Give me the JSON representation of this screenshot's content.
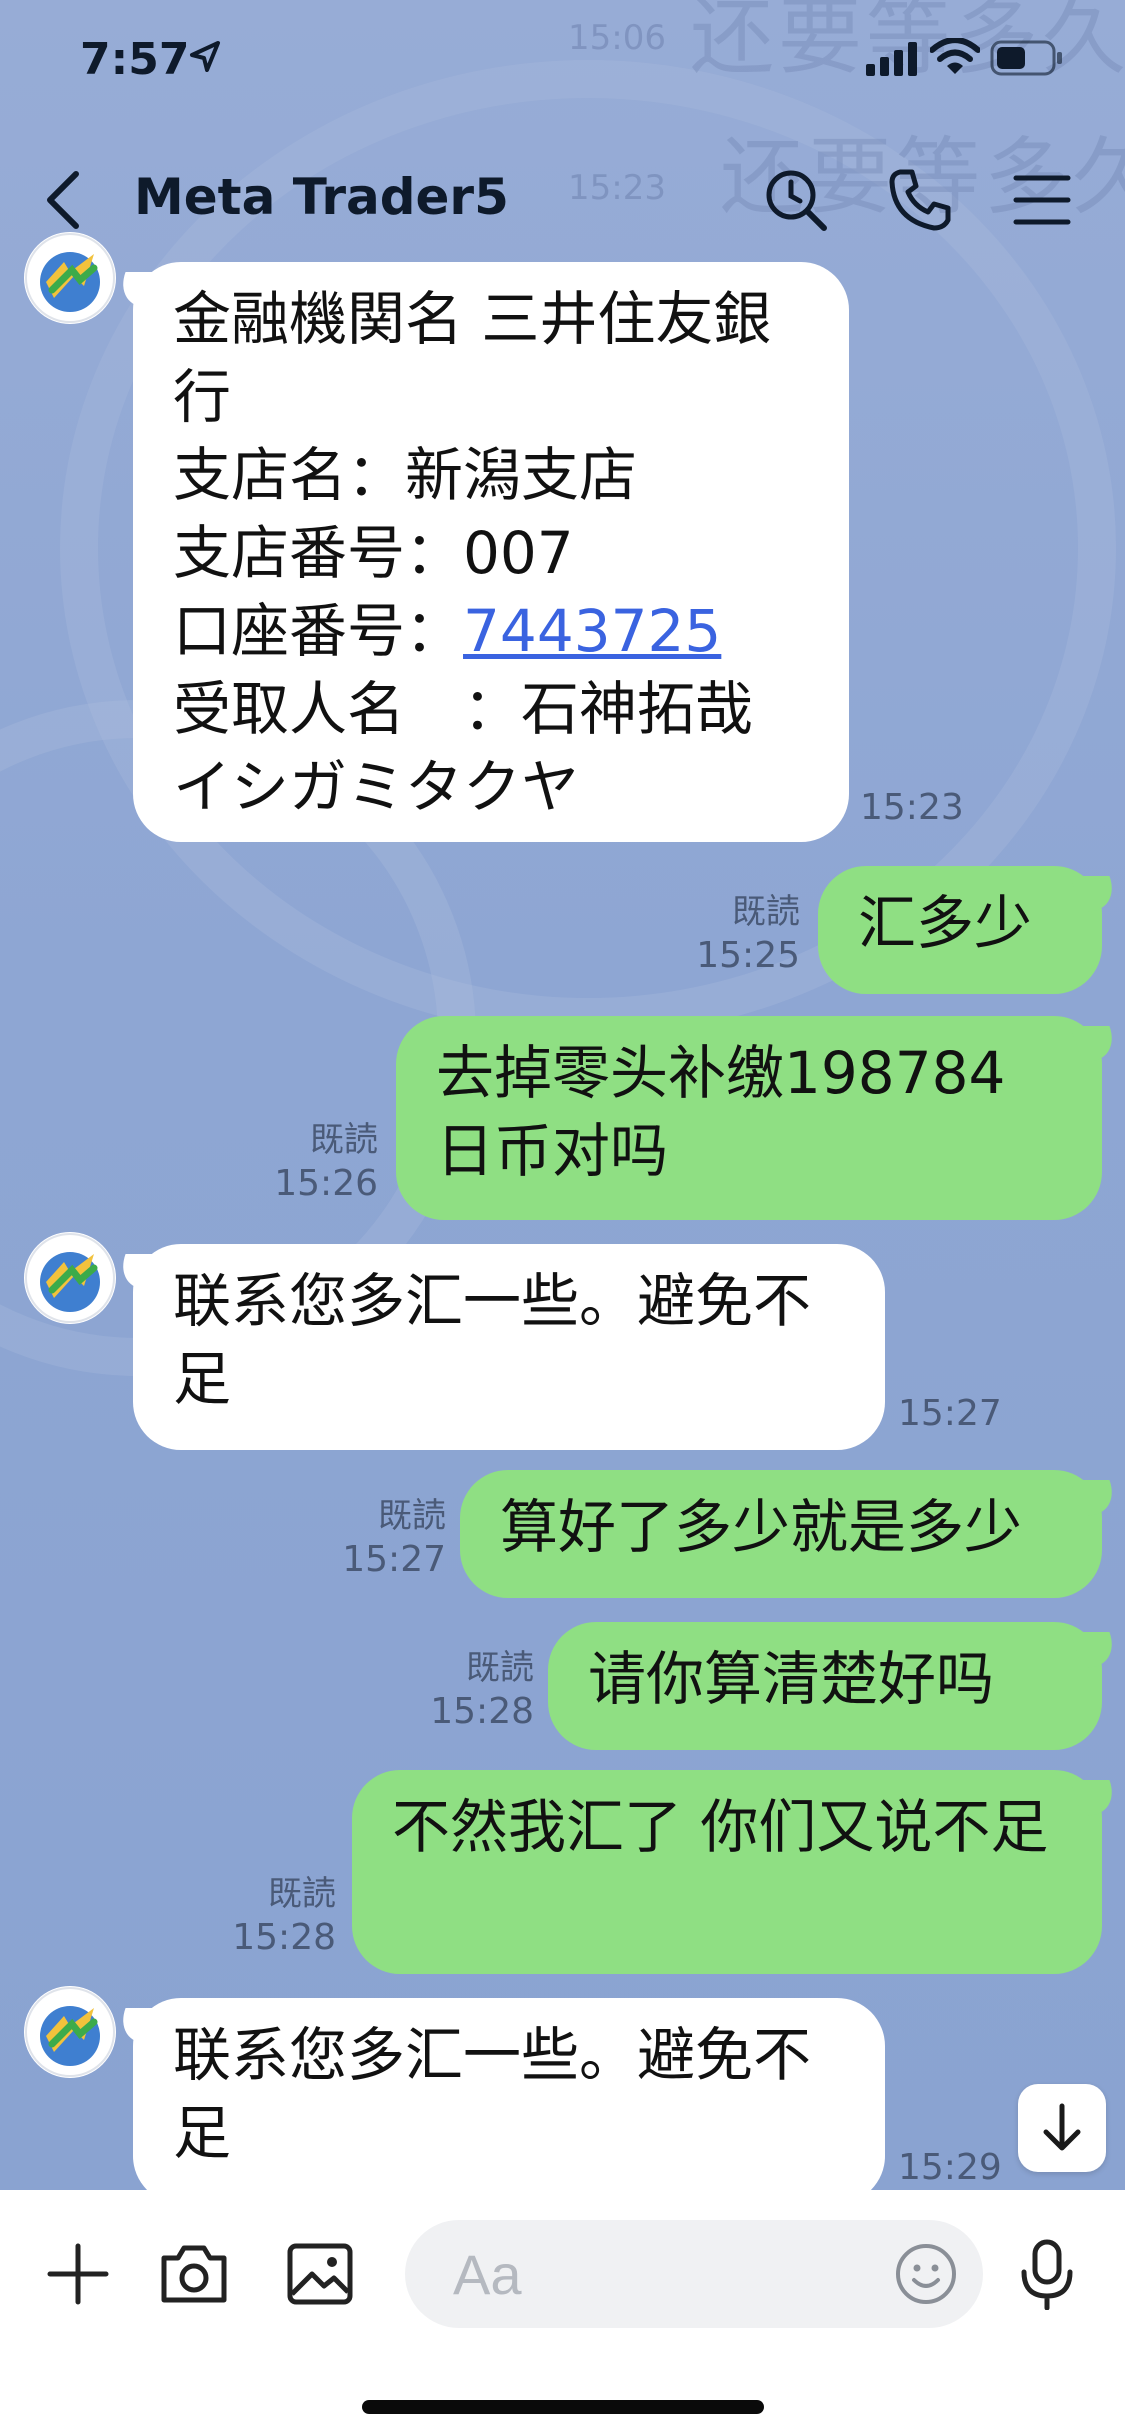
{
  "status_bar": {
    "time": "7:57"
  },
  "header": {
    "title": "Meta Trader5"
  },
  "watermark": {
    "text1": "还要等多久",
    "text2": "还要等多久",
    "time1": "15:06",
    "time2": "15:23"
  },
  "messages": [
    {
      "dir": "in",
      "text_before": "金融機関名 三井住友銀行\n支店名：新潟支店\n支店番号：007\n口座番号：",
      "link": "7443725",
      "text_after": "\n受取人名　：石神拓哉\nイシガミタクヤ",
      "time": "15:23"
    },
    {
      "dir": "out",
      "text": "汇多少",
      "read": "既読",
      "time": "15:25"
    },
    {
      "dir": "out",
      "text": "去掉零头补缴198784日币对吗",
      "read": "既読",
      "time": "15:26"
    },
    {
      "dir": "in",
      "text": "联系您多汇一些。避免不足",
      "time": "15:27"
    },
    {
      "dir": "out",
      "text": "算好了多少就是多少",
      "read": "既読",
      "time": "15:27"
    },
    {
      "dir": "out",
      "text": "请你算清楚好吗",
      "read": "既読",
      "time": "15:28"
    },
    {
      "dir": "out",
      "text": "不然我汇了 你们又说不足",
      "read": "既読",
      "time": "15:28"
    },
    {
      "dir": "in",
      "text": "联系您多汇一些。避免不足",
      "time": "15:29"
    }
  ],
  "input": {
    "placeholder": "Aa"
  },
  "colors": {
    "chat_bg": "#8fa6d2",
    "outgoing": "#8fdf83",
    "incoming": "#ffffff",
    "link": "#3a63e0"
  },
  "icons": [
    "location-arrow-icon",
    "signal-icon",
    "wifi-icon",
    "battery-icon",
    "back-icon",
    "search-icon",
    "phone-icon",
    "menu-icon",
    "plus-icon",
    "camera-icon",
    "image-icon",
    "emoji-icon",
    "mic-icon",
    "arrow-down-icon"
  ]
}
